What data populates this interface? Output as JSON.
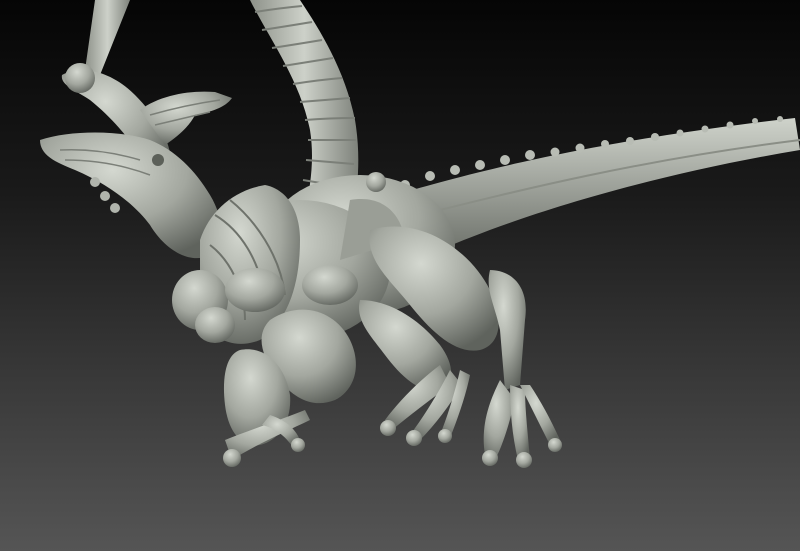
{
  "scene": {
    "subject": "creature-sculpt",
    "colors": {
      "background_top": "#050505",
      "background_bottom": "#555555",
      "clay_light": "#c9cdc6",
      "clay_mid": "#a3a79f",
      "clay_dark": "#6c706a"
    }
  }
}
